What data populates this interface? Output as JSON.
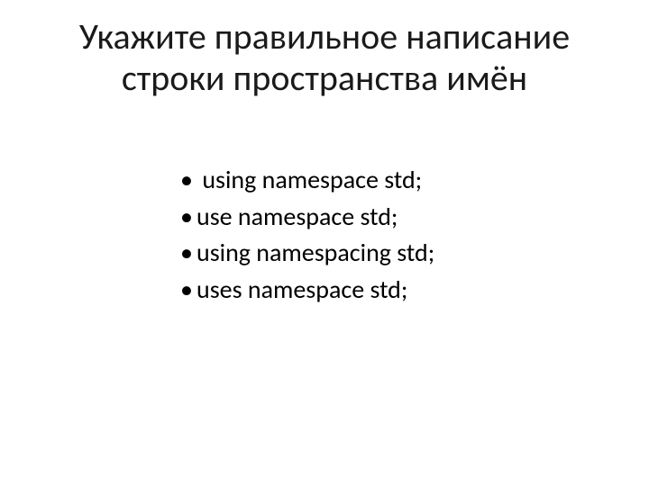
{
  "title_line1": "Укажите правильное написание",
  "title_line2": "строки пространства имён",
  "options": [
    " using namespace std;",
    "use namespace std;",
    "using namespacing std;",
    "uses namespace std;"
  ]
}
